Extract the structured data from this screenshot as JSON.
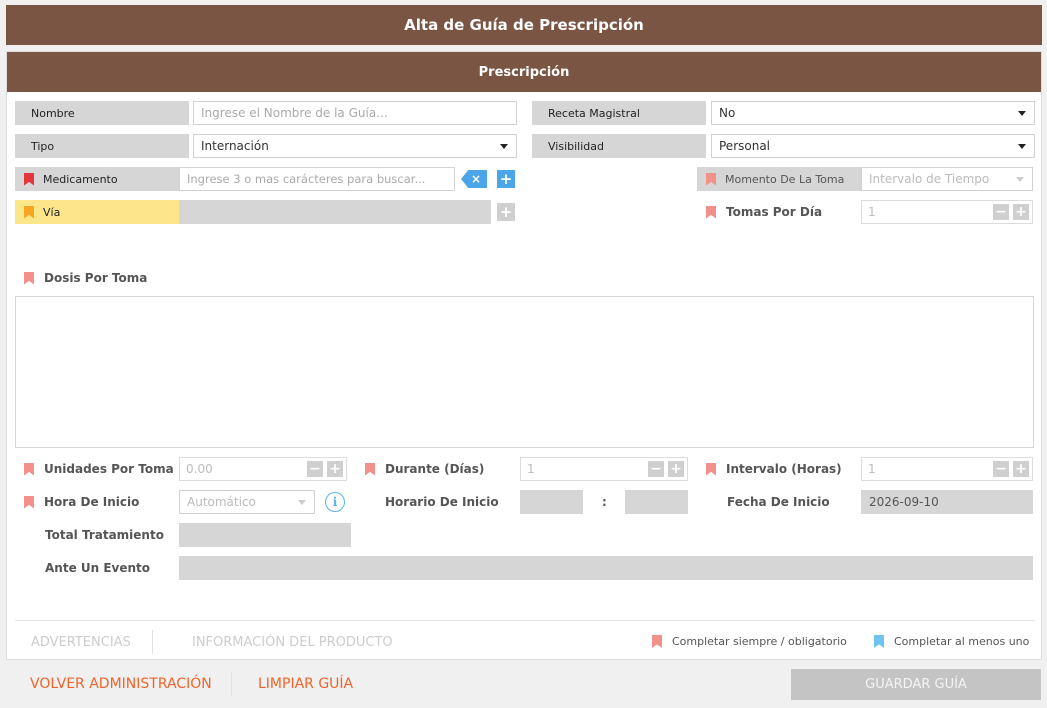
{
  "window": {
    "title": "Alta de Guía de Prescripción"
  },
  "panel": {
    "title": "Prescripción"
  },
  "form": {
    "nombre": {
      "label": "Nombre",
      "placeholder": "Ingrese el Nombre de la Guía..."
    },
    "receta": {
      "label": "Receta Magistral",
      "value": "No"
    },
    "tipo": {
      "label": "Tipo",
      "value": "Internación"
    },
    "visibilidad": {
      "label": "Visibilidad",
      "value": "Personal"
    },
    "medicamento": {
      "label": "Medicamento",
      "placeholder": "Ingrese 3 o mas carácteres para buscar..."
    },
    "momento": {
      "label": "Momento De La Toma",
      "value": "Intervalo de Tiempo"
    },
    "via": {
      "label": "Vía"
    },
    "tomas": {
      "label": "Tomas Por Día",
      "value": "1"
    },
    "dosis": {
      "label": "Dosis Por Toma"
    },
    "unidades": {
      "label": "Unidades Por Toma",
      "value": "0.00"
    },
    "durante": {
      "label": "Durante (Días)",
      "value": "1"
    },
    "intervalo": {
      "label": "Intervalo (Horas)",
      "value": "1"
    },
    "hora_inicio": {
      "label": "Hora De Inicio",
      "value": "Automático"
    },
    "horario_inicio": {
      "label": "Horario De Inicio",
      "separator": ":"
    },
    "fecha_inicio": {
      "label": "Fecha De Inicio",
      "value": "2026-09-10"
    },
    "total": {
      "label": "Total Tratamiento"
    },
    "evento": {
      "label": "Ante Un Evento"
    }
  },
  "stepper": {
    "minus": "−",
    "plus": "+"
  },
  "tabs": {
    "advertencias": "ADVERTENCIAS",
    "info_producto": "INFORMACIÓN DEL PRODUCTO"
  },
  "legend": {
    "obligatorio": "Completar siempre / obligatorio",
    "al_menos_uno": "Completar al menos uno"
  },
  "footer": {
    "volver": "VOLVER ADMINISTRACIÓN",
    "limpiar": "LIMPIAR GUÍA",
    "guardar": "GUARDAR GUÍA"
  },
  "icons": {
    "clear": "×",
    "add": "+",
    "info": "i"
  },
  "colors": {
    "header": "#7a5544",
    "required": "#e2343a",
    "required_light": "#f2908a",
    "at_least_one": "#6ec4ee",
    "accent": "#4aa6e8",
    "link": "#f0632a"
  }
}
